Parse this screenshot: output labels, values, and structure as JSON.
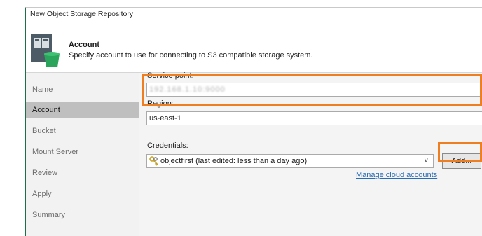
{
  "window": {
    "title": "New Object Storage Repository"
  },
  "header": {
    "title": "Account",
    "subtitle": "Specify account to use for connecting to S3 compatible storage system.",
    "icon": "storage-repository-icon"
  },
  "sidebar": {
    "items": [
      {
        "label": "Name",
        "active": false
      },
      {
        "label": "Account",
        "active": true
      },
      {
        "label": "Bucket",
        "active": false
      },
      {
        "label": "Mount Server",
        "active": false
      },
      {
        "label": "Review",
        "active": false
      },
      {
        "label": "Apply",
        "active": false
      },
      {
        "label": "Summary",
        "active": false
      }
    ]
  },
  "form": {
    "service_point": {
      "label": "Service point:",
      "value": "192.168.1.10:9000"
    },
    "region": {
      "label": "Region:",
      "value": "us-east-1"
    },
    "credentials": {
      "label": "Credentials:",
      "selected": "objectfirst (last edited: less than a day ago)",
      "add_label": "Add...",
      "manage_link": "Manage cloud accounts"
    }
  },
  "colors": {
    "highlight": "#ef7d22",
    "link": "#2a6db5",
    "active_nav": "#bfbfbf",
    "window_edge": "#1f6e4a"
  }
}
